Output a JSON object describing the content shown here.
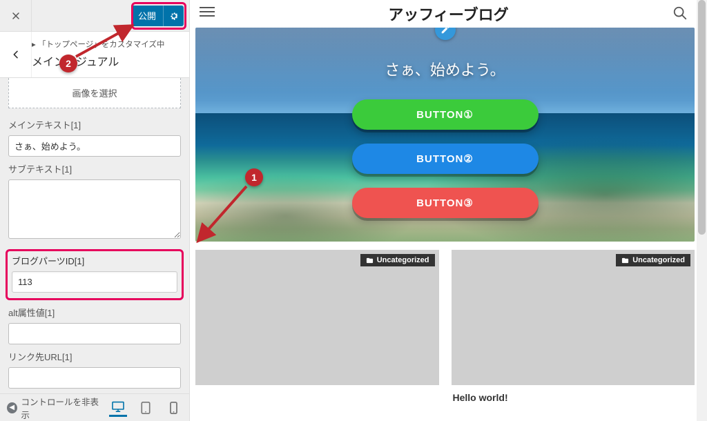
{
  "sidebar": {
    "publish_label": "公開",
    "breadcrumb": "「トップページ」をカスタマイズ中",
    "section_title": "メインビジュアル",
    "image_select_label": "画像を選択",
    "fields": {
      "main_text": {
        "label": "メインテキスト[1]",
        "value": "さぁ、始めよう。"
      },
      "sub_text": {
        "label": "サブテキスト[1]",
        "value": ""
      },
      "blog_parts_id": {
        "label": "ブログパーツID[1]",
        "value": "113"
      },
      "alt": {
        "label": "alt属性値[1]",
        "value": ""
      },
      "link_url": {
        "label": "リンク先URL[1]",
        "value": ""
      }
    },
    "collapse_label": "コントロールを非表示"
  },
  "preview": {
    "site_title": "アッフィーブログ",
    "hero_text": "さぁ、始めよう。",
    "buttons": {
      "b1": "BUTTON①",
      "b2": "BUTTON②",
      "b3": "BUTTON③"
    },
    "cards": [
      {
        "category": "Uncategorized",
        "title": ""
      },
      {
        "category": "Uncategorized",
        "title": "Hello world!"
      }
    ]
  },
  "annotations": {
    "m1": "1",
    "m2": "2"
  },
  "colors": {
    "highlight": "#e6005c",
    "marker": "#c1272d",
    "primary": "#0073aa"
  }
}
